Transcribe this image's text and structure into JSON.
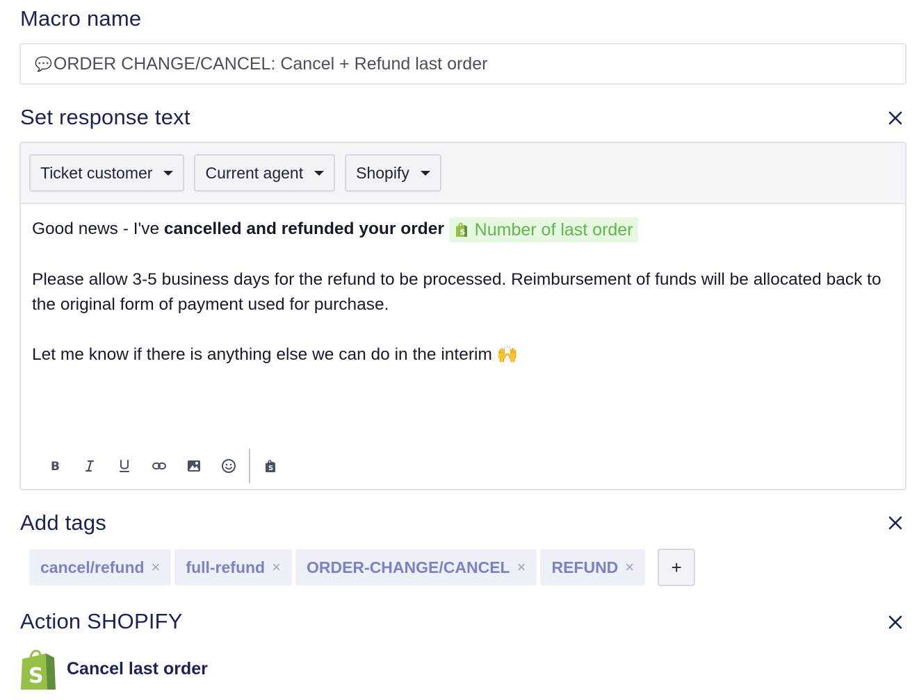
{
  "macro_name": {
    "label": "Macro name",
    "value": "ORDER CHANGE/CANCEL: Cancel + Refund last order",
    "value_icon": "speech-bubble-icon"
  },
  "response_text": {
    "label": "Set response text",
    "variable_dropdowns": [
      "Ticket customer",
      "Current agent",
      "Shopify"
    ],
    "body": {
      "line1_prefix": "Good news - I've ",
      "line1_bold": "cancelled and refunded your order",
      "line1_variable": "Number of last order",
      "paragraph2": "Please allow 3-5 business days for the refund to be processed. Reimbursement of funds will be allocated back to the original form of payment used for purchase.",
      "paragraph3": "Let me know if there is anything else we can do in the interim",
      "paragraph3_emoji": "🙌"
    },
    "toolbar": [
      "bold-icon",
      "italic-icon",
      "underline-icon",
      "link-icon",
      "image-icon",
      "emoji-icon",
      "shopify-variable-icon"
    ]
  },
  "tags": {
    "label": "Add tags",
    "items": [
      "cancel/refund",
      "full-refund",
      "ORDER-CHANGE/CANCEL",
      "REFUND"
    ],
    "remove_glyph": "×",
    "add_glyph": "+"
  },
  "action": {
    "label": "Action SHOPIFY",
    "name": "Cancel last order",
    "icon": "shopify-bag-icon"
  },
  "colors": {
    "heading": "#1c2257",
    "tag_text": "#7a82c2",
    "variable_chip_bg": "#e6f7e2",
    "variable_chip_text": "#5fb74a",
    "shopify_green": "#95bf47"
  }
}
